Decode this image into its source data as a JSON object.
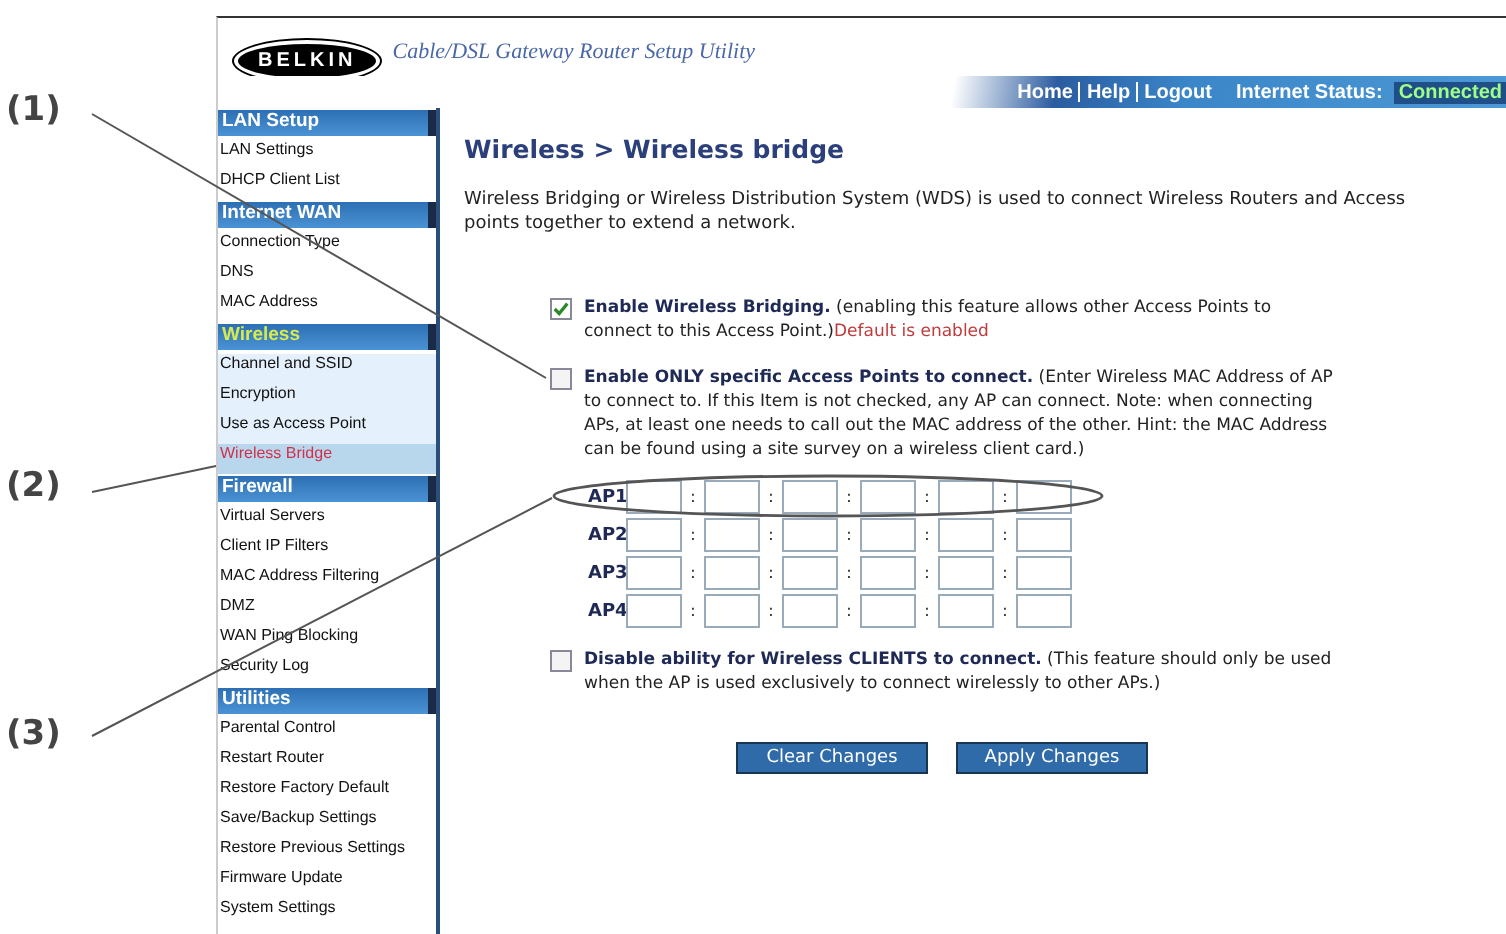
{
  "header": {
    "logo": "BELKIN",
    "title": "Cable/DSL Gateway Router Setup Utility",
    "links": [
      "Home",
      "Help",
      "Logout"
    ],
    "status_label": "Internet Status:",
    "status_value": "Connected"
  },
  "sidebar": {
    "sections": [
      {
        "title": "LAN Setup",
        "active": false,
        "items": [
          {
            "label": "LAN Settings",
            "selected": false
          },
          {
            "label": "DHCP Client List",
            "selected": false
          }
        ]
      },
      {
        "title": "Internet WAN",
        "active": false,
        "items": [
          {
            "label": "Connection Type",
            "selected": false
          },
          {
            "label": "DNS",
            "selected": false
          },
          {
            "label": "MAC Address",
            "selected": false
          }
        ]
      },
      {
        "title": "Wireless",
        "active": true,
        "items": [
          {
            "label": "Channel and SSID",
            "selected": false
          },
          {
            "label": "Encryption",
            "selected": false
          },
          {
            "label": "Use as Access Point",
            "selected": false
          },
          {
            "label": "Wireless Bridge",
            "selected": true
          }
        ]
      },
      {
        "title": "Firewall",
        "active": false,
        "items": [
          {
            "label": "Virtual Servers",
            "selected": false
          },
          {
            "label": "Client IP Filters",
            "selected": false
          },
          {
            "label": "MAC Address Filtering",
            "selected": false
          },
          {
            "label": "DMZ",
            "selected": false
          },
          {
            "label": "WAN Ping Blocking",
            "selected": false
          },
          {
            "label": "Security Log",
            "selected": false
          }
        ]
      },
      {
        "title": "Utilities",
        "active": false,
        "items": [
          {
            "label": "Parental Control",
            "selected": false
          },
          {
            "label": "Restart Router",
            "selected": false
          },
          {
            "label": "Restore Factory Default",
            "selected": false
          },
          {
            "label": "Save/Backup Settings",
            "selected": false
          },
          {
            "label": "Restore Previous Settings",
            "selected": false
          },
          {
            "label": "Firmware Update",
            "selected": false
          },
          {
            "label": "System Settings",
            "selected": false
          }
        ]
      }
    ]
  },
  "content": {
    "title": "Wireless > Wireless bridge",
    "intro": "Wireless Bridging or Wireless Distribution System (WDS) is used to connect Wireless Routers and Access points together to extend a network.",
    "options": [
      {
        "text": "**Enable Wireless Bridging.** (enabling this feature allows other Access Points to connect to this Access Point.)",
        "default_note": "Default is enabled",
        "checked": true
      },
      {
        "text": "**Enable ONLY specific Access Points to connect.** (Enter Wireless MAC Address of AP to connect to. If this Item is not checked, any AP can connect. Note: when connecting APs, at least one needs to call out the MAC address of the other. Hint: the MAC Address can be found using a site survey on a wireless client card.)",
        "checked": false
      }
    ],
    "mac_rows": [
      {
        "label": "AP1",
        "separators": [
          ":",
          ":",
          ":",
          ":",
          ":"
        ]
      },
      {
        "label": "AP2",
        "separators": [
          ":",
          ":",
          ":",
          ":",
          ":"
        ]
      },
      {
        "label": "AP3",
        "separators": [
          ":",
          ":",
          ":",
          ":",
          ":"
        ]
      },
      {
        "label": "AP4",
        "separators": [
          ":",
          ":",
          ":",
          ":",
          ":"
        ]
      }
    ],
    "client_option": {
      "text": "**Disable ability for Wireless CLIENTS to connect.** (This feature should only be used when the AP is used exclusively to connect wirelessly to other APs.)",
      "checked": false
    },
    "buttons": [
      "Clear Changes",
      "Apply Changes"
    ]
  },
  "callouts": [
    {
      "label": "(1)"
    },
    {
      "label": "(2)"
    },
    {
      "label": "(3)"
    }
  ]
}
